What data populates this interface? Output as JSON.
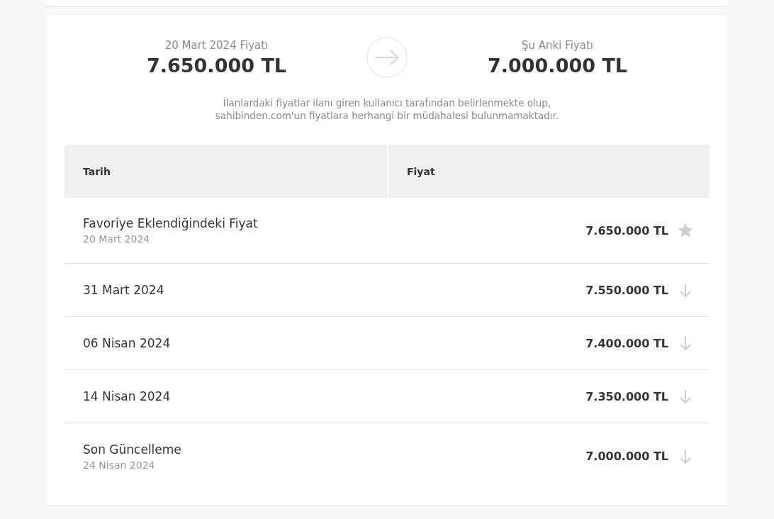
{
  "comparison": {
    "from": {
      "label": "20 Mart 2024 Fiyatı",
      "price": "7.650.000 TL"
    },
    "to": {
      "label": "Şu Anki Fiyatı",
      "price": "7.000.000 TL"
    }
  },
  "disclaimer": "İlanlardaki fiyatlar ilanı giren kullanıcı tarafından belirlenmekte olup, sahibinden.com'un fiyatlara herhangi bir müdahalesi bulunmamaktadır.",
  "table": {
    "columns": [
      "Tarih",
      "Fiyat"
    ],
    "rows": [
      {
        "kind": "favorite",
        "title": "Favoriye Eklendiğindeki Fiyat",
        "date": "20 Mart 2024",
        "price": "7.650.000 TL"
      },
      {
        "kind": "drop",
        "title": "31 Mart 2024",
        "price": "7.550.000 TL"
      },
      {
        "kind": "drop",
        "title": "06 Nisan 2024",
        "price": "7.400.000 TL"
      },
      {
        "kind": "drop",
        "title": "14 Nisan 2024",
        "price": "7.350.000 TL"
      },
      {
        "kind": "drop",
        "title": "Son Güncelleme",
        "date": "24 Nisan 2024",
        "price": "7.000.000 TL"
      }
    ]
  }
}
